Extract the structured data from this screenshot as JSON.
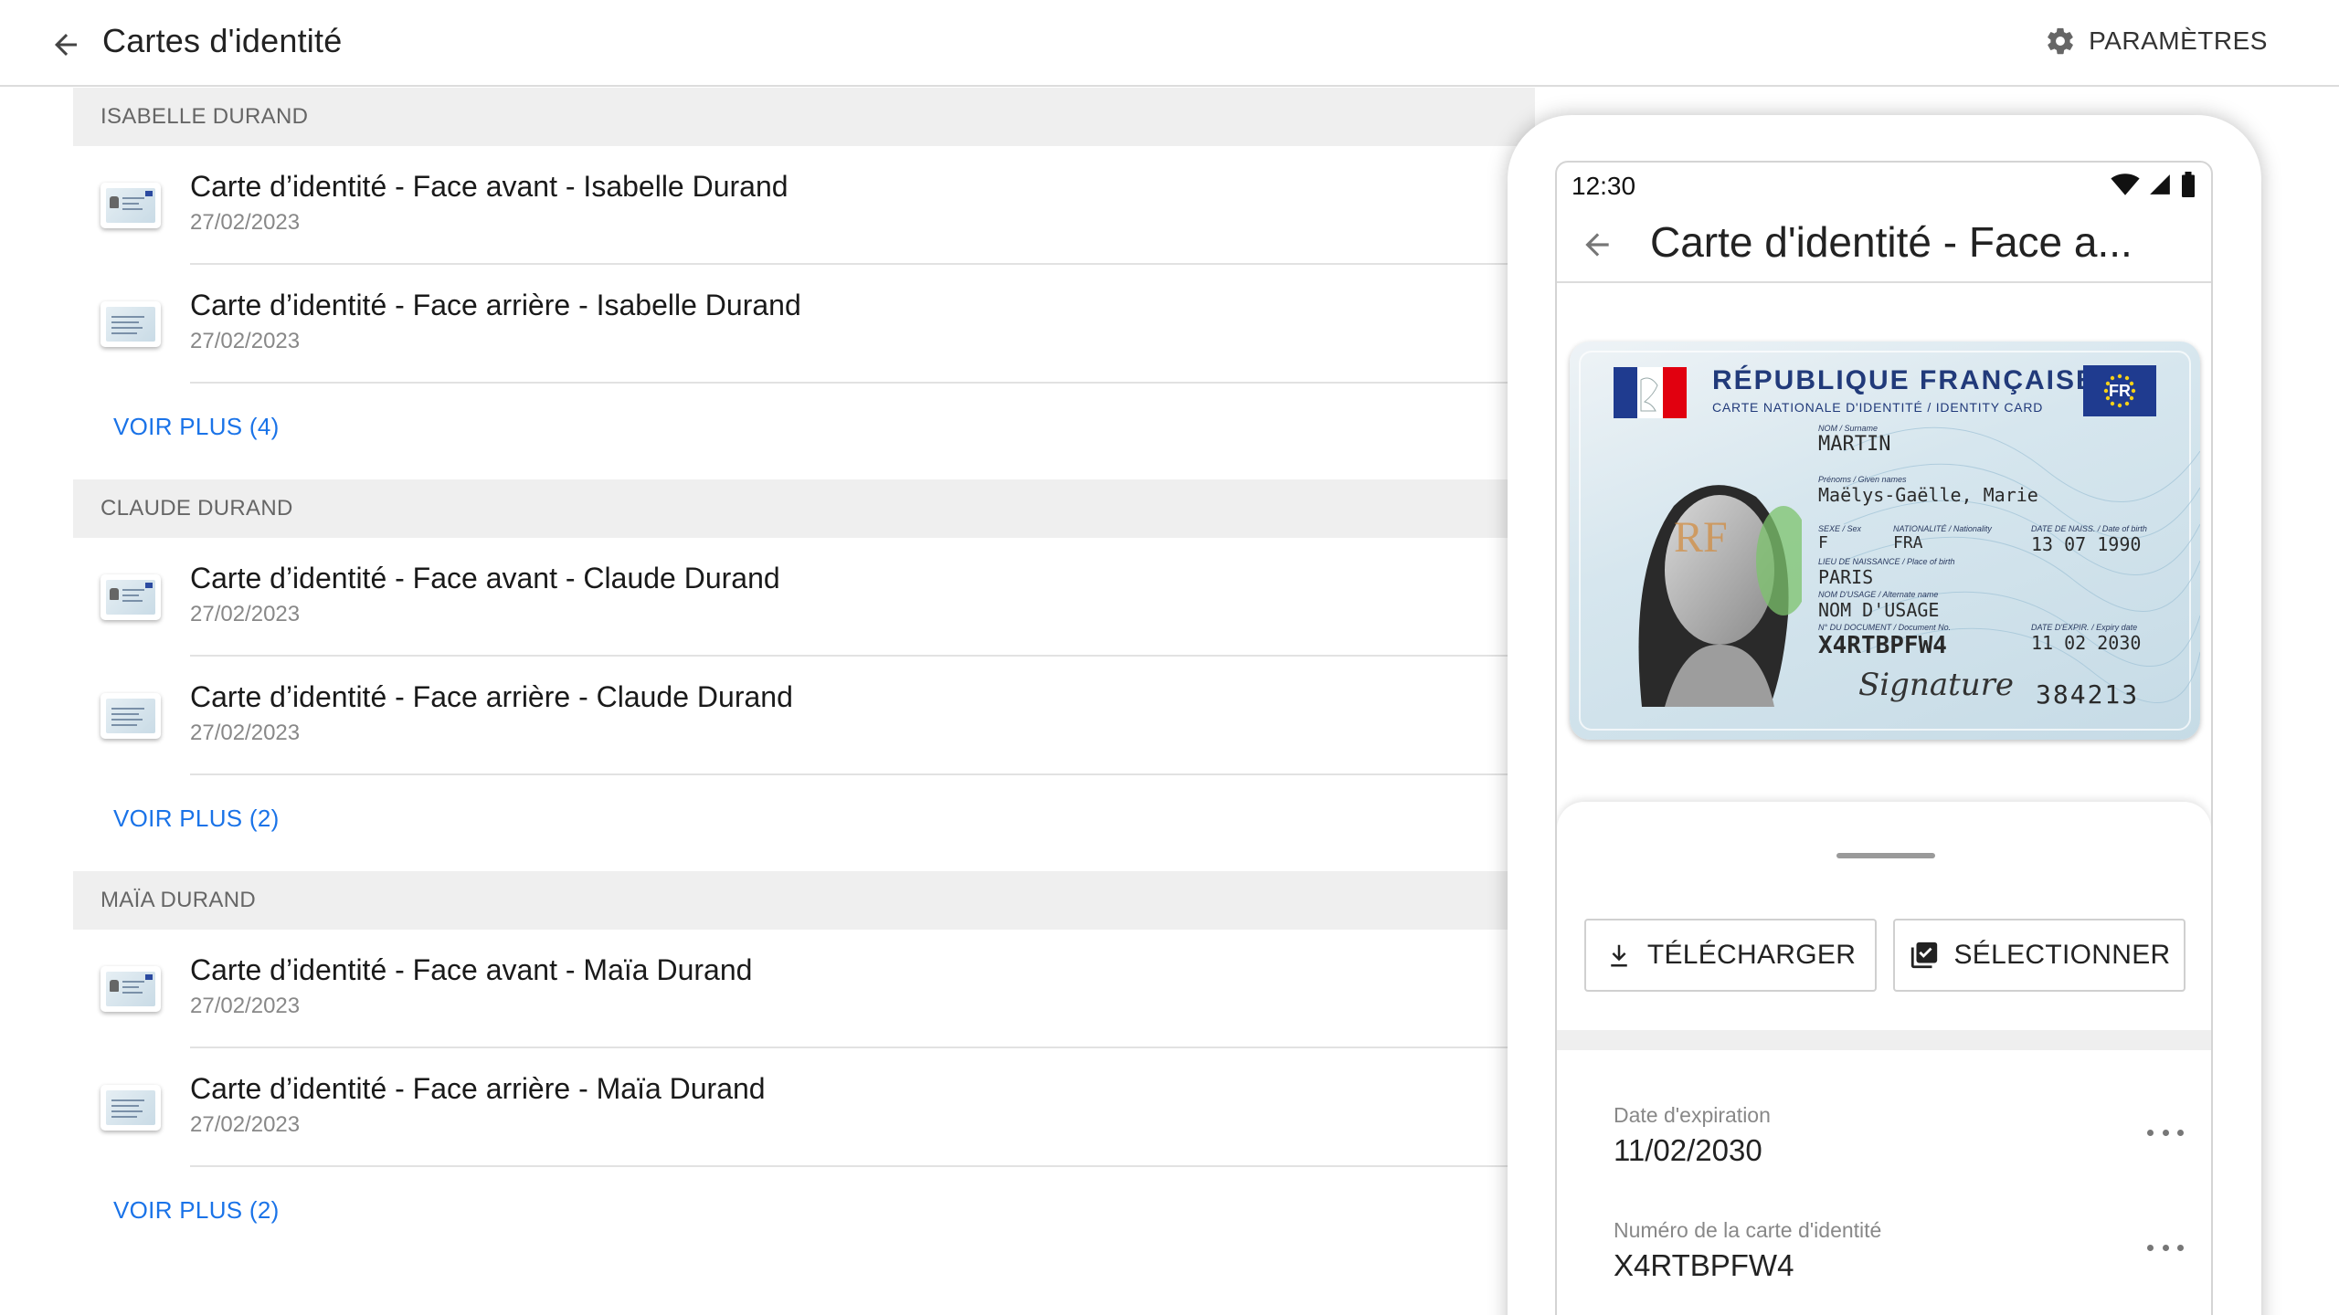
{
  "header": {
    "title": "Cartes d'identité",
    "settings_label": "PARAMÈTRES"
  },
  "groups": [
    {
      "name": "ISABELLE DURAND",
      "items": [
        {
          "title": "Carte d’identité - Face avant - Isabelle Durand",
          "date": "27/02/2023"
        },
        {
          "title": "Carte d’identité - Face arrière - Isabelle Durand",
          "date": "27/02/2023"
        }
      ],
      "more": "VOIR PLUS (4)"
    },
    {
      "name": "CLAUDE DURAND",
      "items": [
        {
          "title": "Carte d’identité - Face avant - Claude Durand",
          "date": "27/02/2023"
        },
        {
          "title": "Carte d’identité - Face arrière - Claude Durand",
          "date": "27/02/2023"
        }
      ],
      "more": "VOIR PLUS (2)"
    },
    {
      "name": "MAÏA DURAND",
      "items": [
        {
          "title": "Carte d’identité - Face avant - Maïa Durand",
          "date": "27/02/2023"
        },
        {
          "title": "Carte d’identité - Face arrière - Maïa Durand",
          "date": "27/02/2023"
        }
      ],
      "more": "VOIR PLUS (2)"
    }
  ],
  "phone": {
    "time": "12:30",
    "title": "Carte d'identité - Face a...",
    "card": {
      "country": "RÉPUBLIQUE FRANÇAISE",
      "subtitle": "CARTE NATIONALE D'IDENTITÉ / IDENTITY CARD",
      "eu_code": "FR",
      "surname_label": "NOM / Surname",
      "surname": "MARTIN",
      "given_label": "Prénoms / Given names",
      "given": "Maëlys-Gaëlle, Marie",
      "sex_label": "SEXE / Sex",
      "sex": "F",
      "nationality_label": "NATIONALITÉ / Nationality",
      "nationality": "FRA",
      "birthdate_label": "DATE DE NAISS. / Date of birth",
      "birthdate": "13 07 1990",
      "birthplace_label": "LIEU DE NAISSANCE / Place of birth",
      "birthplace": "PARIS",
      "usage_label": "NOM D'USAGE / Alternate name",
      "usage": "NOM D'USAGE",
      "docno_label": "N° DU DOCUMENT / Document No.",
      "docno": "X4RTBPFW4",
      "expiry_label": "DATE D'EXPIR. / Expiry date",
      "expiry": "11 02 2030",
      "signature": "Signature",
      "can": "384213",
      "watermark": "RF"
    },
    "actions": {
      "download": "TÉLÉCHARGER",
      "select": "SÉLECTIONNER"
    },
    "details": [
      {
        "label": "Date d'expiration",
        "value": "11/02/2030"
      },
      {
        "label": "Numéro de la carte d'identité",
        "value": "X4RTBPFW4"
      }
    ]
  },
  "colors": {
    "accent": "#1a73e8",
    "section_bg": "#efefef",
    "card_blue": "#213a7a"
  }
}
